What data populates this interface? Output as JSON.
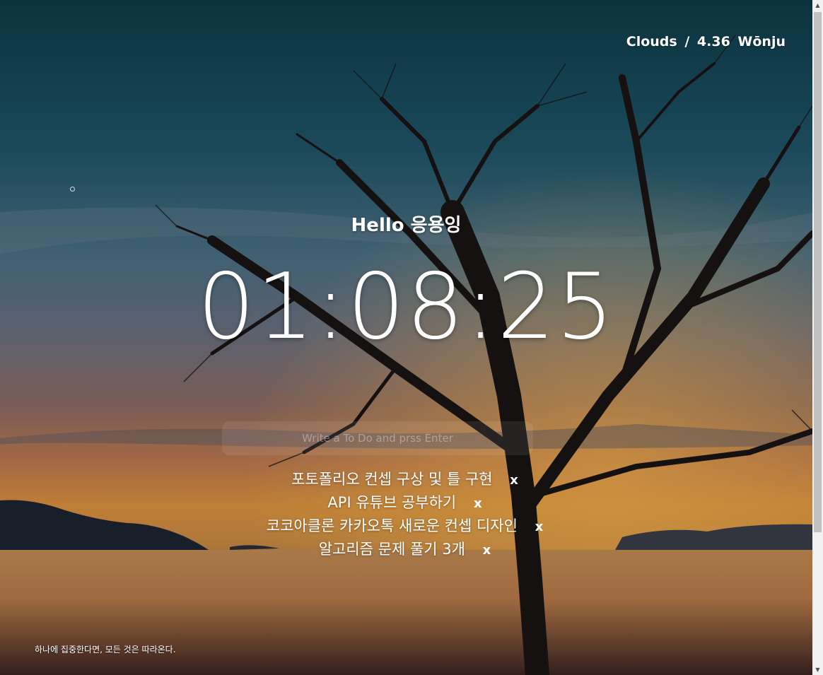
{
  "weather": {
    "condition": "Clouds",
    "separator": "/",
    "temperature": "4.36",
    "city": "Wōnju"
  },
  "greeting": "Hello 응용잉",
  "clock": "01:08:25",
  "todo_form": {
    "placeholder": "Write a To Do and prss Enter"
  },
  "todos": [
    {
      "text": "포토폴리오 컨셉 구상 및 틀 구현",
      "delete_label": "x"
    },
    {
      "text": "API 유튜브 공부하기",
      "delete_label": "x"
    },
    {
      "text": "코코아클론 카카오톡 새로운 컨셉 디자인",
      "delete_label": "x"
    },
    {
      "text": "알고리즘 문제 풀기 3개",
      "delete_label": "x"
    }
  ],
  "quote": "하나에 집중한다면, 모든 것은 따라온다.",
  "icons": {
    "scroll_up": "scroll-up-arrow-icon",
    "scroll_down": "scroll-down-arrow-icon"
  },
  "colors": {
    "text": "#ffffff",
    "scrollbar_track": "#f1f1f1",
    "scrollbar_thumb": "#c1c1c1"
  }
}
